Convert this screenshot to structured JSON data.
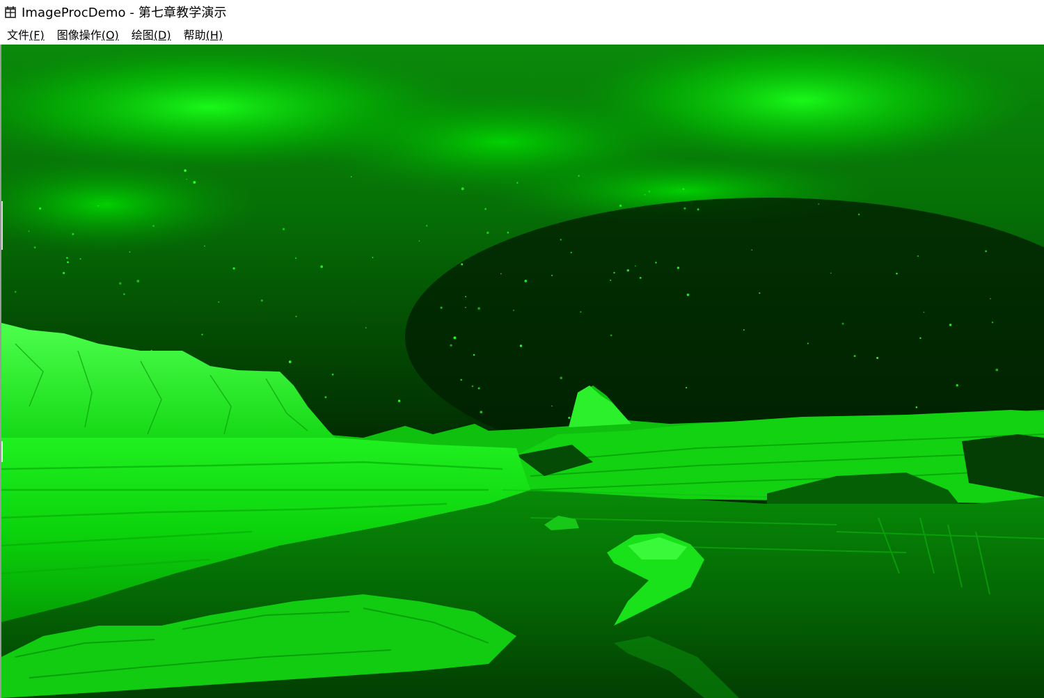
{
  "window": {
    "title": "ImageProcDemo - 第七章教学演示",
    "icon": "app-window-icon"
  },
  "menubar": {
    "items": [
      {
        "label": "文件",
        "mnemonic": "(F)"
      },
      {
        "label": "图像操作",
        "mnemonic": "(O)"
      },
      {
        "label": "绘图",
        "mnemonic": "(D)"
      },
      {
        "label": "帮助",
        "mnemonic": "(H)"
      }
    ]
  },
  "image": {
    "description_name": "green-tinted-landscape-image",
    "tint_color": "#00ff00",
    "dark_color": "#003300"
  }
}
